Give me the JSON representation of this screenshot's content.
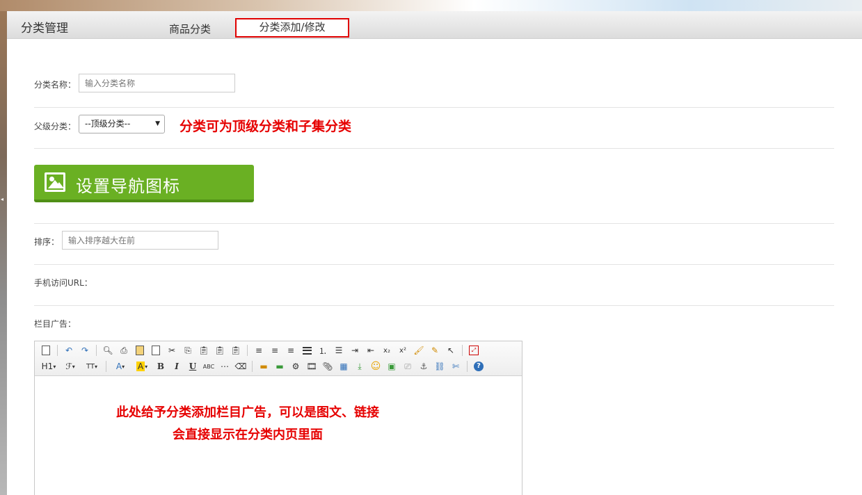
{
  "header": {
    "title": "分类管理",
    "tabs": [
      {
        "label": "商品分类",
        "active": false
      },
      {
        "label": "分类添加/修改",
        "active": true
      }
    ]
  },
  "form": {
    "category_name": {
      "label": "分类名称：",
      "placeholder": "输入分类名称",
      "value": ""
    },
    "parent_category": {
      "label": "父级分类：",
      "selected": "--顶级分类--"
    },
    "parent_note": "分类可为顶级分类和子集分类",
    "nav_icon_button": {
      "label": "设置导航图标",
      "icon": "image-icon"
    },
    "sort": {
      "label": "排序：",
      "placeholder": "输入排序越大在前",
      "value": ""
    },
    "mobile_url": {
      "label": "手机访问URL："
    },
    "column_ad": {
      "label": "栏目广告："
    }
  },
  "editor": {
    "toolbar_row2_text": {
      "heading": "H1",
      "font_family": "ℱ",
      "font_size": "TT",
      "font_color": "A",
      "highlight": "A",
      "bold": "B",
      "italic": "I",
      "underline": "U",
      "strike": "ABC"
    },
    "note_line1": "此处给予分类添加栏目广告，可以是图文、链接",
    "note_line2": "会直接显示在分类内页里面"
  },
  "colors": {
    "accent_red": "#e60000",
    "button_green": "#6ab023",
    "tab_border": "#e00000"
  }
}
